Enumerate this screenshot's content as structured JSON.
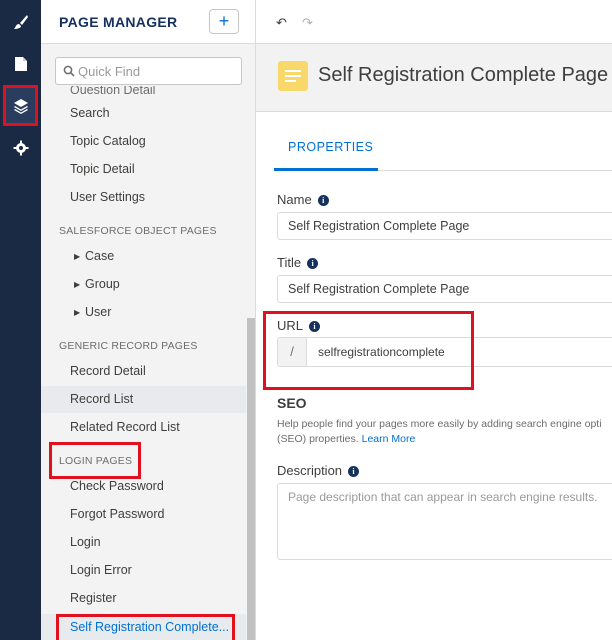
{
  "rail": {
    "items": [
      {
        "icon": "paintbrush-icon"
      },
      {
        "icon": "page-icon"
      },
      {
        "icon": "layers-icon"
      },
      {
        "icon": "gear-icon"
      }
    ]
  },
  "page_manager": {
    "title": "PAGE MANAGER",
    "add_label": "+",
    "search_placeholder": "Quick Find",
    "clipped_item": "Question Detail",
    "items_top": [
      "Search",
      "Topic Catalog",
      "Topic Detail",
      "User Settings"
    ],
    "section_object": "SALESFORCE OBJECT PAGES",
    "object_items": [
      "Case",
      "Group",
      "User"
    ],
    "section_generic": "GENERIC RECORD PAGES",
    "generic_items": [
      "Record Detail",
      "Record List",
      "Related Record List"
    ],
    "section_login": "LOGIN PAGES",
    "login_items": [
      "Check Password",
      "Forgot Password",
      "Login",
      "Login Error",
      "Register",
      "Self Registration Complete..."
    ]
  },
  "toolbar": {
    "undo": "↶",
    "redo": "↷"
  },
  "page": {
    "heading": "Self Registration Complete Page",
    "tab": "PROPERTIES",
    "name_label": "Name",
    "name_value": "Self Registration Complete Page",
    "title_label": "Title",
    "title_value": "Self Registration Complete Page",
    "url_label": "URL",
    "url_prefix": "/",
    "url_value": "selfregistrationcomplete",
    "seo_title": "SEO",
    "seo_help_1": "Help people find your pages more easily by adding search engine opti",
    "seo_help_2": "(SEO) properties.",
    "seo_link": "Learn More",
    "description_label": "Description",
    "description_placeholder": "Page description that can appear in search engine results."
  },
  "colors": {
    "accent": "#0070d2",
    "rail": "#1a2944",
    "highlight_box": "#e0101e",
    "page_icon": "#f8d86a"
  }
}
